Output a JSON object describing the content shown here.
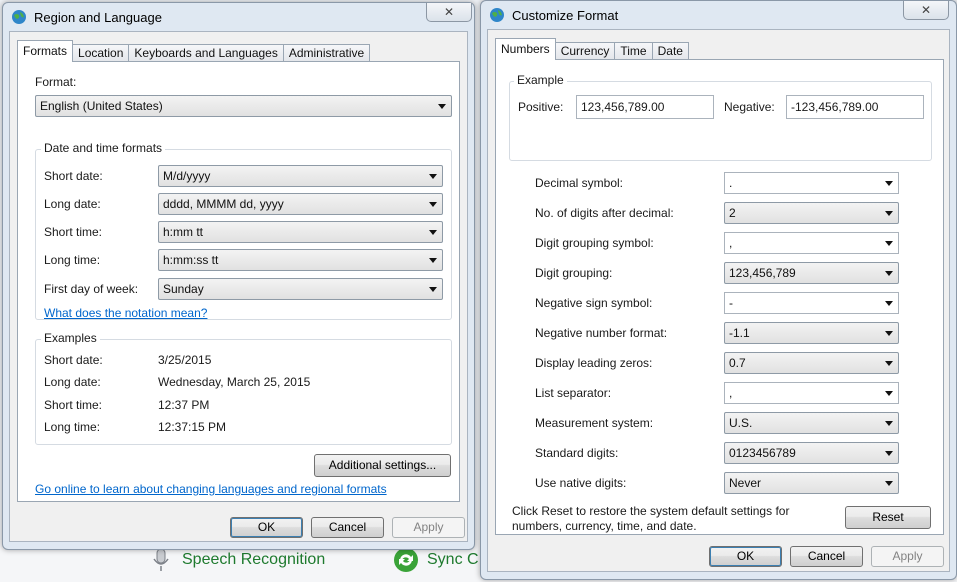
{
  "background": {
    "items": [
      {
        "label": "Speech Recognition",
        "icon": "microphone-icon"
      },
      {
        "label": "Sync C",
        "icon": "sync-center-icon"
      }
    ]
  },
  "region_window": {
    "title": "Region and Language",
    "close_label": "✕",
    "tabs": [
      "Formats",
      "Location",
      "Keyboards and Languages",
      "Administrative"
    ],
    "active_tab": "Formats",
    "format_label": "Format:",
    "format_value": "English (United States)",
    "datetime_group_title": "Date and time formats",
    "fields": [
      {
        "label": "Short date:",
        "value": "M/d/yyyy"
      },
      {
        "label": "Long date:",
        "value": "dddd, MMMM dd, yyyy"
      },
      {
        "label": "Short time:",
        "value": "h:mm tt"
      },
      {
        "label": "Long time:",
        "value": "h:mm:ss tt"
      },
      {
        "label": "First day of week:",
        "value": "Sunday"
      }
    ],
    "notation_link": "What does the notation mean?",
    "examples_group_title": "Examples",
    "examples": [
      {
        "label": "Short date:",
        "value": "3/25/2015"
      },
      {
        "label": "Long date:",
        "value": "Wednesday, March 25, 2015"
      },
      {
        "label": "Short time:",
        "value": "12:37 PM"
      },
      {
        "label": "Long time:",
        "value": "12:37:15 PM"
      }
    ],
    "additional_settings_label": "Additional settings...",
    "online_link": "Go online to learn about changing languages and regional formats",
    "ok_label": "OK",
    "cancel_label": "Cancel",
    "apply_label": "Apply"
  },
  "customize_window": {
    "title": "Customize Format",
    "close_label": "✕",
    "tabs": [
      "Numbers",
      "Currency",
      "Time",
      "Date"
    ],
    "active_tab": "Numbers",
    "example_group_title": "Example",
    "positive_label": "Positive:",
    "positive_value": "123,456,789.00",
    "negative_label": "Negative:",
    "negative_value": "-123,456,789.00",
    "settings": [
      {
        "label": "Decimal symbol:",
        "value": ".",
        "editable": true
      },
      {
        "label": "No. of digits after decimal:",
        "value": "2",
        "editable": false
      },
      {
        "label": "Digit grouping symbol:",
        "value": ",",
        "editable": true
      },
      {
        "label": "Digit grouping:",
        "value": "123,456,789",
        "editable": false
      },
      {
        "label": "Negative sign symbol:",
        "value": "-",
        "editable": true
      },
      {
        "label": "Negative number format:",
        "value": "-1.1",
        "editable": false
      },
      {
        "label": "Display leading zeros:",
        "value": "0.7",
        "editable": false
      },
      {
        "label": "List separator:",
        "value": ",",
        "editable": true
      },
      {
        "label": "Measurement system:",
        "value": "U.S.",
        "editable": false
      },
      {
        "label": "Standard digits:",
        "value": "0123456789",
        "editable": false
      },
      {
        "label": "Use native digits:",
        "value": "Never",
        "editable": false
      }
    ],
    "reset_note": "Click Reset to restore the system default settings for numbers, currency, time, and date.",
    "reset_label": "Reset",
    "ok_label": "OK",
    "cancel_label": "Cancel",
    "apply_label": "Apply"
  },
  "colors": {
    "link": "#0066cc",
    "frame": "#dfe8f2",
    "background_text": "#1e7a2e"
  }
}
